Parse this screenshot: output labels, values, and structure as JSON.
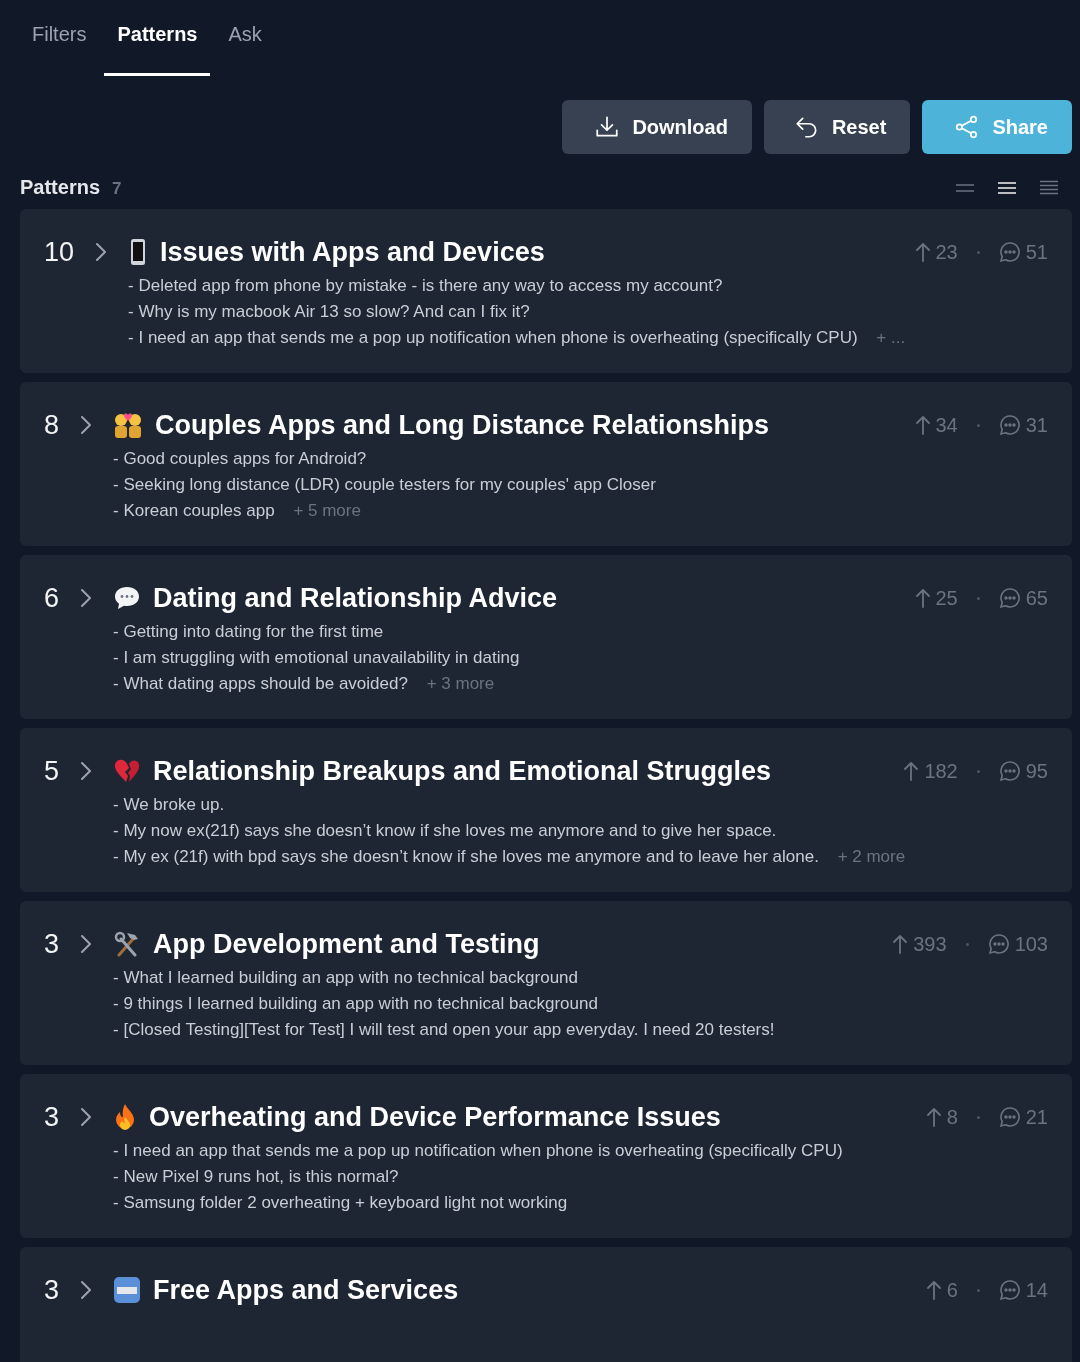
{
  "tabs": [
    {
      "label": "Filters",
      "selected": false
    },
    {
      "label": "Patterns",
      "selected": true
    },
    {
      "label": "Ask",
      "selected": false
    }
  ],
  "actions": [
    {
      "kind": "download",
      "label": "Download"
    },
    {
      "kind": "reset",
      "label": "Reset"
    },
    {
      "kind": "share",
      "label": "Share"
    }
  ],
  "section": {
    "title": "Patterns",
    "count": "7"
  },
  "density_options": [
    {
      "kind": "compact",
      "selected": false
    },
    {
      "kind": "normal",
      "selected": true
    },
    {
      "kind": "dense",
      "selected": false
    }
  ],
  "patterns": [
    {
      "rank": "10",
      "kind": "phone",
      "title": "Issues with Apps and Devices",
      "upvotes": "23",
      "comments": "51",
      "posts": [
        "- Deleted app from phone by mistake - is there any way to access my account?",
        "- Why is my macbook Air 13 so slow? And can I fix it?",
        "- I need an app that sends me a pop up notification when phone is overheating (specifically CPU)"
      ],
      "more": "+ ..."
    },
    {
      "rank": "8",
      "kind": "couple",
      "title": "Couples Apps and Long Distance Relationships",
      "upvotes": "34",
      "comments": "31",
      "posts": [
        "- Good couples apps for Android?",
        "- Seeking long distance (LDR) couple testers for my couples' app Closer",
        "- Korean couples app"
      ],
      "more": "+ 5 more"
    },
    {
      "rank": "6",
      "kind": "speech",
      "title": "Dating and Relationship Advice",
      "upvotes": "25",
      "comments": "65",
      "posts": [
        "- Getting into dating for the first time",
        "- I am struggling with emotional unavailability in dating",
        "- What dating apps should be avoided?"
      ],
      "more": "+ 3 more"
    },
    {
      "rank": "5",
      "kind": "broken-heart",
      "title": "Relationship Breakups and Emotional Struggles",
      "upvotes": "182",
      "comments": "95",
      "posts": [
        "- We broke up.",
        "- My now ex(21f) says she doesn’t know if she loves me anymore and to give her space.",
        "- My ex (21f) with bpd says she doesn’t know if she loves me anymore and to leave her alone."
      ],
      "more": "+ 2 more"
    },
    {
      "rank": "3",
      "kind": "tools",
      "title": "App Development and Testing",
      "upvotes": "393",
      "comments": "103",
      "posts": [
        "- What I learned building an app with no technical background",
        "- 9 things I learned building an app with no technical background",
        "- [Closed Testing][Test for Test] I will test and open your app everyday. I need 20 testers!"
      ]
    },
    {
      "rank": "3",
      "kind": "fire",
      "title": "Overheating and Device Performance Issues",
      "upvotes": "8",
      "comments": "21",
      "posts": [
        "- I need an app that sends me a pop up notification when phone is overheating (specifically CPU)",
        "- New Pixel 9 runs hot, is this normal?",
        "- Samsung folder 2 overheating + keyboard light not working"
      ]
    },
    {
      "rank": "3",
      "kind": "free",
      "title": "Free Apps and Services",
      "upvotes": "6",
      "comments": "14"
    }
  ]
}
